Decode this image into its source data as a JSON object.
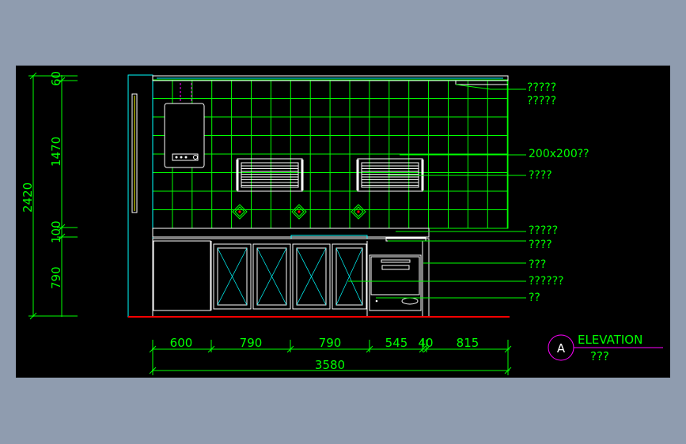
{
  "drawing": {
    "vertical_dims": [
      "60",
      "1470",
      "100",
      "790"
    ],
    "total_height": "2420",
    "horizontal_dims": [
      "600",
      "790",
      "790",
      "545",
      "40",
      "815"
    ],
    "total_width": "3580",
    "labels": [
      "?????",
      "?????",
      "200x200??",
      "????",
      "?????",
      "????",
      "???",
      "??????",
      "??"
    ],
    "marker_letter": "A",
    "view_title": "ELEVATION",
    "view_subtitle": "???"
  },
  "colors": {
    "background": "#000000",
    "frame": "#8f9caf",
    "tile_lines": "#00ff00",
    "annotation": "#00ff00",
    "outline": "#ffffff",
    "cyan": "#00ffff",
    "marker": "#ff00ff",
    "floor": "#ff0000"
  }
}
